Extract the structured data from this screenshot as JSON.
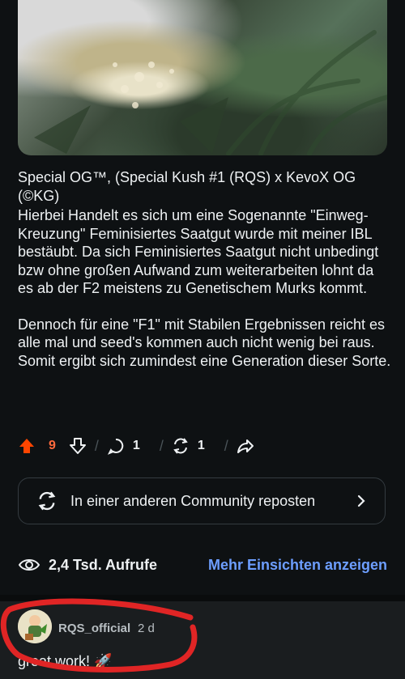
{
  "post": {
    "image_alt": "cannabis bud photo",
    "title": "Special OG™, (Special Kush #1 (RQS) x KevoX OG (©KG)",
    "body": [
      "Hierbei Handelt es sich um eine Sogenannte \"Einweg-Kreuzung\" Feminisiertes Saatgut wurde mit meiner IBL bestäubt. Da sich Feminisiertes Saatgut nicht unbedingt bzw ohne großen Aufwand zum weiterarbeiten lohnt da es ab der F2 meistens zu Genetischem Murks kommt.",
      "Dennoch für eine \"F1\" mit Stabilen Ergebnissen reicht es alle mal und seed's kommen auch nicht wenig bei raus. Somit ergibt sich zumindest eine Generation dieser Sorte."
    ]
  },
  "actions": {
    "upvotes": "9",
    "comments": "1",
    "reposts": "1",
    "upvote_color": "#ff4500"
  },
  "repost": {
    "label": "In einer anderen Community reposten"
  },
  "insights": {
    "views": "2,4 Tsd. Aufrufe",
    "more_label": "Mehr Einsichten anzeigen",
    "link_color": "#6d9eff"
  },
  "comment": {
    "author": "RQS_official",
    "time": "2 d",
    "text": "great work! 🚀"
  }
}
